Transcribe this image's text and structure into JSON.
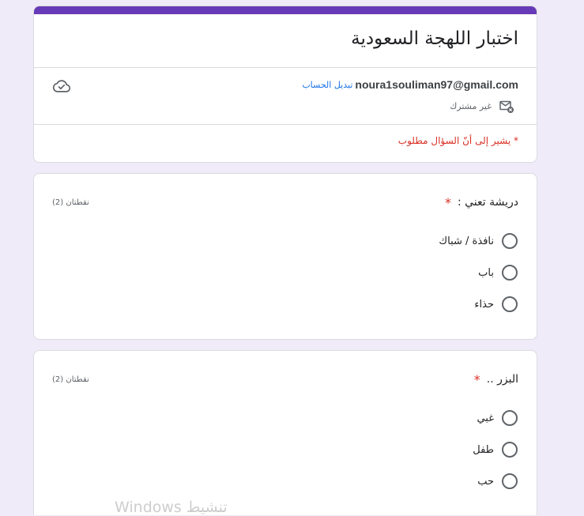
{
  "form": {
    "title": "اختبار اللهجة السعودية",
    "account": {
      "email": "noura1souliman97@gmail.com",
      "switch_account_label": "تبديل الحساب",
      "not_shared_label": "غير مشترك"
    },
    "required_marker": "*",
    "required_note": "يشير إلى أنّ السؤال مطلوب"
  },
  "questions": [
    {
      "title": "دريشة تعني :",
      "required_marker": "*",
      "points": "نقطتان (2)",
      "options": [
        "نافذة / شباك",
        "باب",
        "حذاء"
      ]
    },
    {
      "title": "البزر ..",
      "required_marker": "*",
      "points": "نقطتان (2)",
      "options": [
        "غبي",
        "طفل",
        "حب"
      ]
    }
  ],
  "watermark": {
    "text": "تنشيط Windows"
  },
  "icons": {
    "saved_status": "cloud-done-icon",
    "sharing_status": "mail-off-icon",
    "option_control": "radio-button"
  },
  "colors": {
    "accent": "#673ab7",
    "background": "#f0ebf8",
    "link": "#1a73e8",
    "required": "#d93025"
  }
}
